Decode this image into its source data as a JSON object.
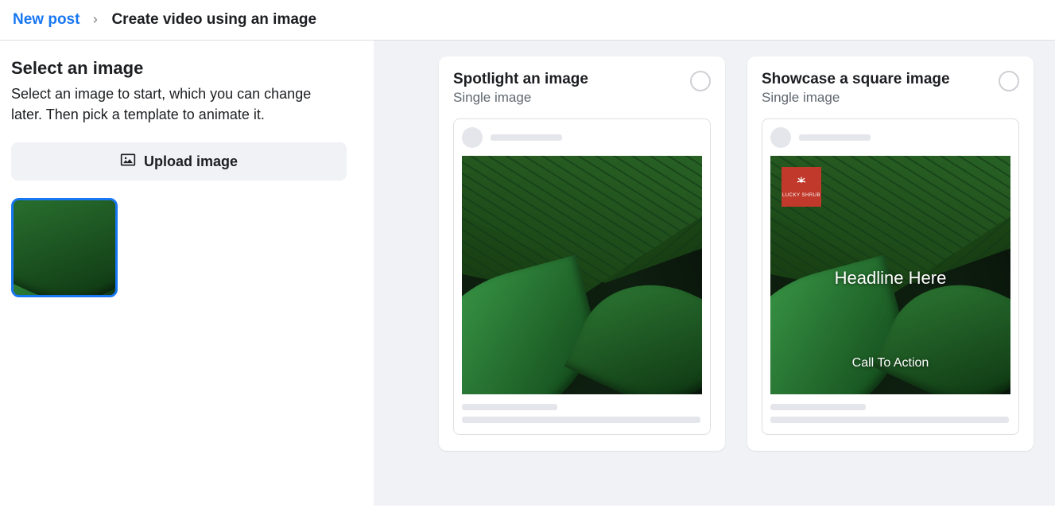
{
  "breadcrumb": {
    "link_label": "New post",
    "current": "Create video using an image"
  },
  "left": {
    "title": "Select an image",
    "description": "Select an image to start, which you can change later. Then pick a template to animate it.",
    "upload_label": "Upload image"
  },
  "templates": [
    {
      "title": "Spotlight an image",
      "subtitle": "Single image",
      "has_overlay": false
    },
    {
      "title": "Showcase a square image",
      "subtitle": "Single image",
      "has_overlay": true,
      "overlay": {
        "logo_text": "LUCKY SHRUB",
        "headline": "Headline Here",
        "cta": "Call To Action"
      }
    }
  ]
}
